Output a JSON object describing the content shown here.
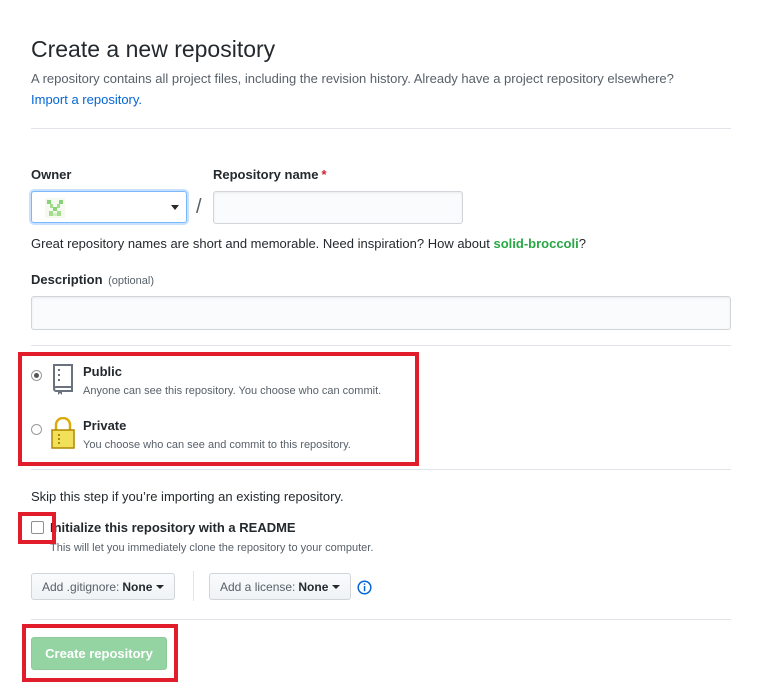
{
  "header": {
    "title": "Create a new repository",
    "subtitle": "A repository contains all project files, including the revision history. Already have a project repository elsewhere?",
    "import_link": "Import a repository."
  },
  "owner": {
    "label": "Owner",
    "value": ""
  },
  "separator": "/",
  "repo_name": {
    "label": "Repository name",
    "required_mark": "*",
    "value": ""
  },
  "name_hint": {
    "text": "Great repository names are short and memorable. Need inspiration? How about",
    "suggestion": "solid-broccoli",
    "end": "?"
  },
  "description": {
    "label": "Description",
    "optional": "(optional)",
    "value": ""
  },
  "visibility": {
    "selected": "public",
    "options": [
      {
        "title": "Public",
        "desc": "Anyone can see this repository. You choose who can commit.",
        "icon": "repo-book-icon"
      },
      {
        "title": "Private",
        "desc": "You choose who can see and commit to this repository.",
        "icon": "lock-icon"
      }
    ]
  },
  "init": {
    "skip_text": "Skip this step if you’re importing an existing repository.",
    "checked": false,
    "label": "Initialize this repository with a README",
    "desc": "This will let you immediately clone the repository to your computer."
  },
  "gitignore": {
    "prefix": "Add .gitignore:",
    "value": "None"
  },
  "license": {
    "prefix": "Add a license:",
    "value": "None"
  },
  "info_icon": "info-icon",
  "submit": {
    "label": "Create repository"
  },
  "colors": {
    "link": "#0366d6",
    "suggestion": "#28a745",
    "submit_bg": "#94d3a2",
    "highlight": "#e11d2b"
  }
}
